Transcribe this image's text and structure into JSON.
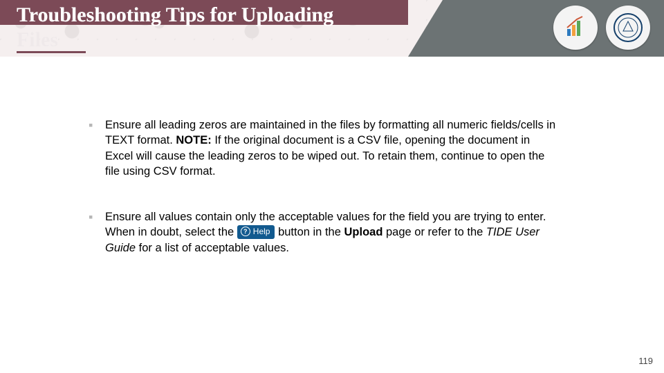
{
  "header": {
    "title_line1": "Troubleshooting Tips for Uploading",
    "title_line2": "Files",
    "logo1_alt": "Assessment logo",
    "logo2_alt": "State seal"
  },
  "bullets": [
    {
      "pre": "Ensure all leading zeros are maintained in the files by formatting all numeric fields/cells in TEXT format. ",
      "note_label": "NOTE:",
      "note_text": " If the original document is a CSV file, opening the document in Excel will cause the leading zeros to be wiped out. To retain them, continue to open the file using CSV format."
    },
    {
      "pre": "Ensure all values contain only the acceptable values for the field you are trying to enter. When in doubt, select the ",
      "help_label": "Help",
      "mid": " button in the ",
      "bold1": "Upload",
      "mid2": " page or refer to the ",
      "italic1": "TIDE User Guide",
      "tail": " for a list of acceptable values."
    }
  ],
  "page_number": "119"
}
